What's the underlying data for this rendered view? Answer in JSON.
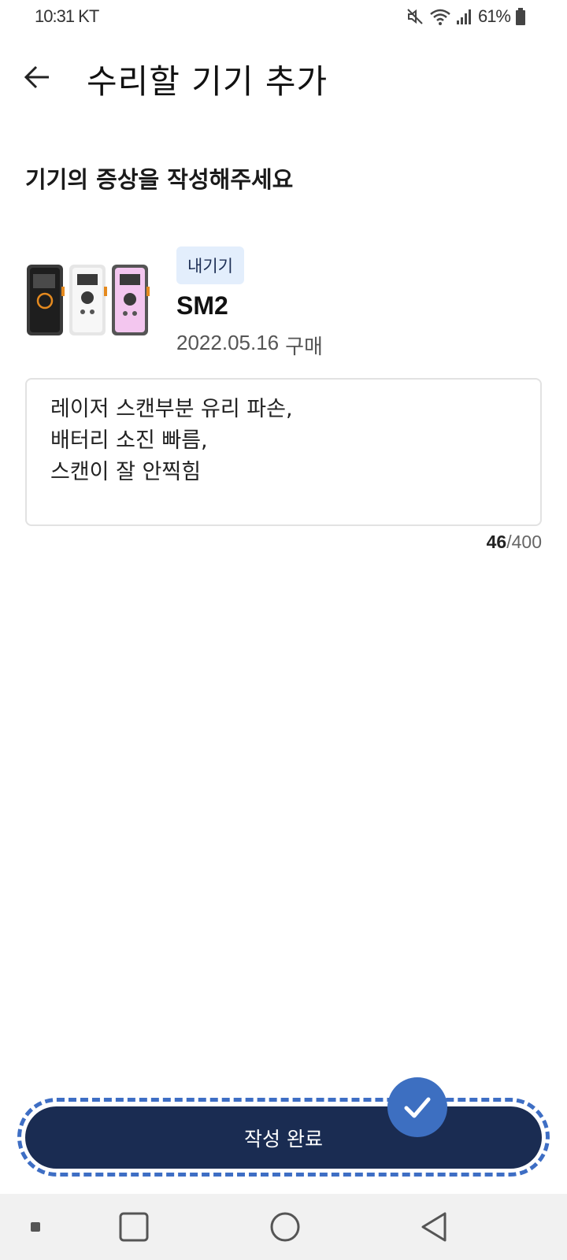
{
  "status_bar": {
    "time": "10:31 KT",
    "battery_percent": "61%",
    "icons": [
      "mute-icon",
      "wifi-icon",
      "signal-icon",
      "battery-icon"
    ]
  },
  "header": {
    "back_icon": "arrow-left-icon",
    "title": "수리할 기기 추가"
  },
  "section_title": "기기의 증상을 작성해주세요",
  "device": {
    "badge": "내기기",
    "model": "SM2",
    "purchase_date": "2022.05.16",
    "purchase_suffix": "구매",
    "image_colors": [
      "#2b2b2b",
      "#f2f2f2",
      "#f3c6ef"
    ],
    "accent_color": "#e58a1f"
  },
  "symptom": {
    "text": "레이저 스캔부분 유리 파손,\n배터리 소진 빠름,\n스캔이 잘 안찍힘",
    "count_current": "46",
    "count_separator": "/",
    "count_max": "400"
  },
  "submit": {
    "label": "작성 완료",
    "color": "#1a2c52",
    "highlight_color": "#3d6fc1"
  },
  "nav_bar": {
    "icons": [
      "recent-apps-icon",
      "home-icon",
      "back-icon"
    ]
  }
}
